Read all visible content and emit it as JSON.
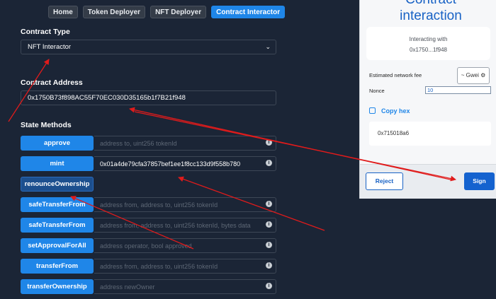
{
  "nav": {
    "home": "Home",
    "token_deployer": "Token Deployer",
    "nft_deployer": "NFT Deployer",
    "contract_interactor": "Contract Interactor"
  },
  "contract_type": {
    "label": "Contract Type",
    "selected": "NFT Interactor"
  },
  "contract_address": {
    "label": "Contract Address",
    "value": "0x1750B73f898AC55F70EC030D35165b1f7B21f948"
  },
  "state_methods": {
    "label": "State Methods",
    "methods": [
      {
        "name": "approve",
        "placeholder": "address to, uint256 tokenId",
        "value": ""
      },
      {
        "name": "mint",
        "placeholder": "",
        "value": "0x01a4de79cfa37857bef1ee1f8cc133d9f558b780"
      },
      {
        "name": "renounceOwnership",
        "placeholder": "",
        "value": ""
      },
      {
        "name": "safeTransferFrom",
        "placeholder": "address from, address to, uint256 tokenId",
        "value": ""
      },
      {
        "name": "safeTransferFrom",
        "placeholder": "address from, address to, uint256 tokenId, bytes data",
        "value": ""
      },
      {
        "name": "setApprovalForAll",
        "placeholder": "address operator, bool approved",
        "value": ""
      },
      {
        "name": "transferFrom",
        "placeholder": "address from, address to, uint256 tokenId",
        "value": ""
      },
      {
        "name": "transferOwnership",
        "placeholder": "address newOwner",
        "value": ""
      }
    ]
  },
  "panel": {
    "title_line1": "Contract",
    "title_line2": "interaction",
    "interacting_with": "Interacting with",
    "short_address": "0x1750...1f948",
    "fee_label": "Estimated network fee",
    "gwei": "~ Gwei",
    "nonce_label": "Nonce",
    "nonce_value": "10",
    "copy_hex": "Copy hex",
    "hex_value": "0x715018a6",
    "reject": "Reject",
    "sign": "Sign"
  },
  "colors": {
    "background": "#1b2536",
    "primary": "#1f86e8",
    "annotation": "#e01b1b"
  },
  "icons": {
    "info": "info-icon",
    "chevron": "chevron-down-icon",
    "gear": "gear-icon",
    "copy": "copy-icon"
  }
}
